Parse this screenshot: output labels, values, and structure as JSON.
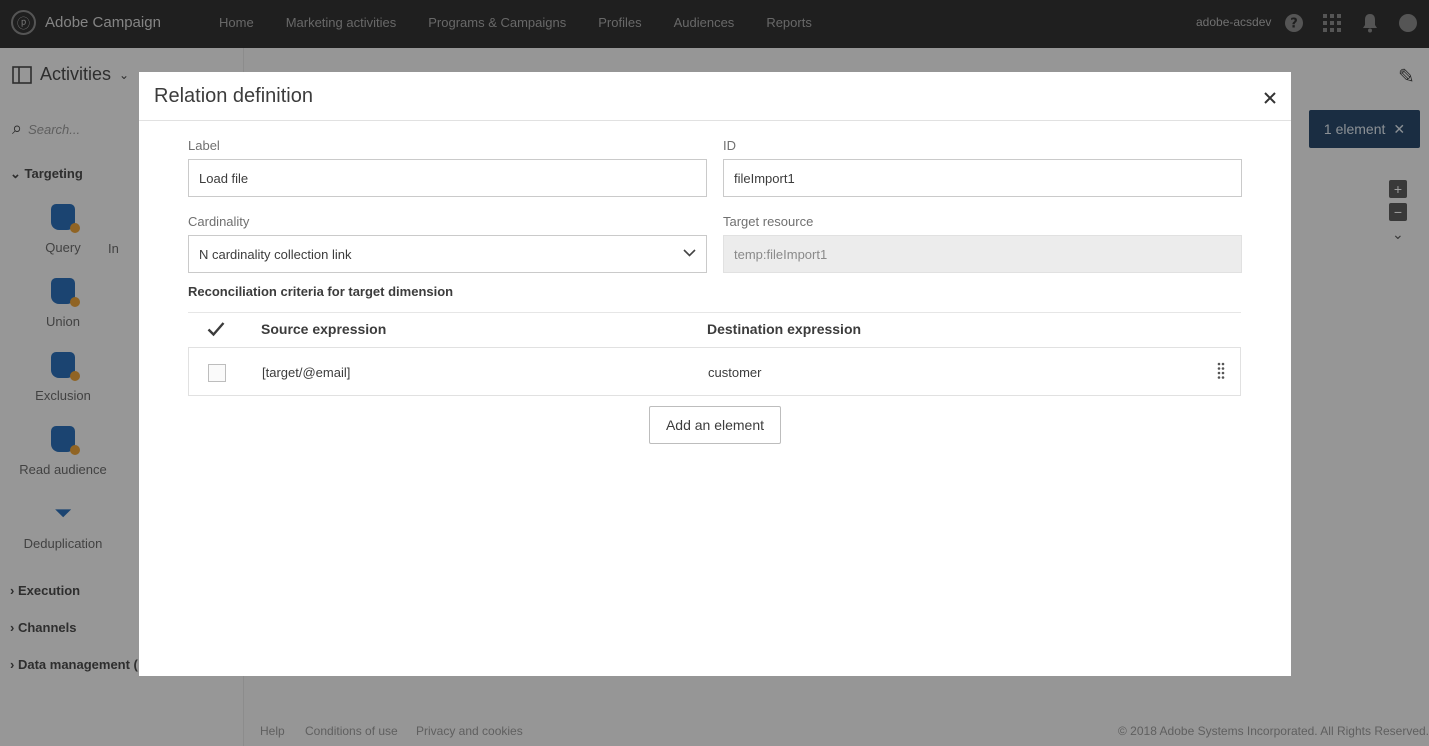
{
  "topbar": {
    "brand": "Adobe Campaign",
    "nav": [
      "Home",
      "Marketing activities",
      "Programs & Campaigns",
      "Profiles",
      "Audiences",
      "Reports"
    ],
    "user": "adobe-acsdev"
  },
  "sidebar": {
    "title": "Activities",
    "search_placeholder": "Search...",
    "targeting_label": "Targeting",
    "activities": [
      "Query",
      "Union",
      "Exclusion",
      "Read audience",
      "Deduplication"
    ],
    "partial_activity": "In",
    "sections": [
      "Execution",
      "Channels",
      "Data management ("
    ]
  },
  "canvas": {
    "element_badge": "1 element"
  },
  "footer": {
    "links": [
      "Help",
      "Conditions of use",
      "Privacy and cookies"
    ],
    "copyright": "© 2018 Adobe Systems Incorporated. All Rights Reserved."
  },
  "modal": {
    "title": "Relation definition",
    "label_label": "Label",
    "label_value": "Load file",
    "id_label": "ID",
    "id_value": "fileImport1",
    "cardinality_label": "Cardinality",
    "cardinality_value": "N cardinality collection link",
    "target_resource_label": "Target resource",
    "target_resource_value": "temp:fileImport1",
    "reconciliation_title": "Reconciliation criteria for target dimension",
    "columns": [
      "Source expression",
      "Destination expression"
    ],
    "rows": [
      {
        "source": "[target/@email]",
        "destination": "customer"
      }
    ],
    "add_button": "Add an element"
  }
}
